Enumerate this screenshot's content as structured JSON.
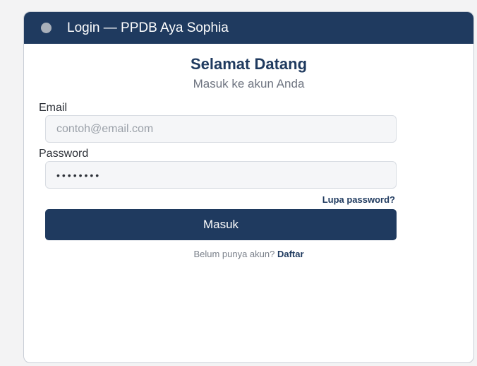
{
  "window": {
    "title": "Login — PPDB Aya Sophia"
  },
  "form": {
    "heading": "Selamat Datang",
    "subheading": "Masuk ke akun Anda",
    "email_label": "Email",
    "email_placeholder": "contoh@email.com",
    "email_value": "",
    "password_label": "Password",
    "password_value": "password",
    "forgot_label": "Lupa password?",
    "submit_label": "Masuk",
    "register_prompt": "Belum punya akun?",
    "register_link": "Daftar"
  },
  "colors": {
    "primary": "#1f3a5f",
    "muted_text": "#6e7480",
    "input_bg": "#f5f6f8"
  },
  "icons": {
    "window_dot": "status-dot-icon"
  }
}
